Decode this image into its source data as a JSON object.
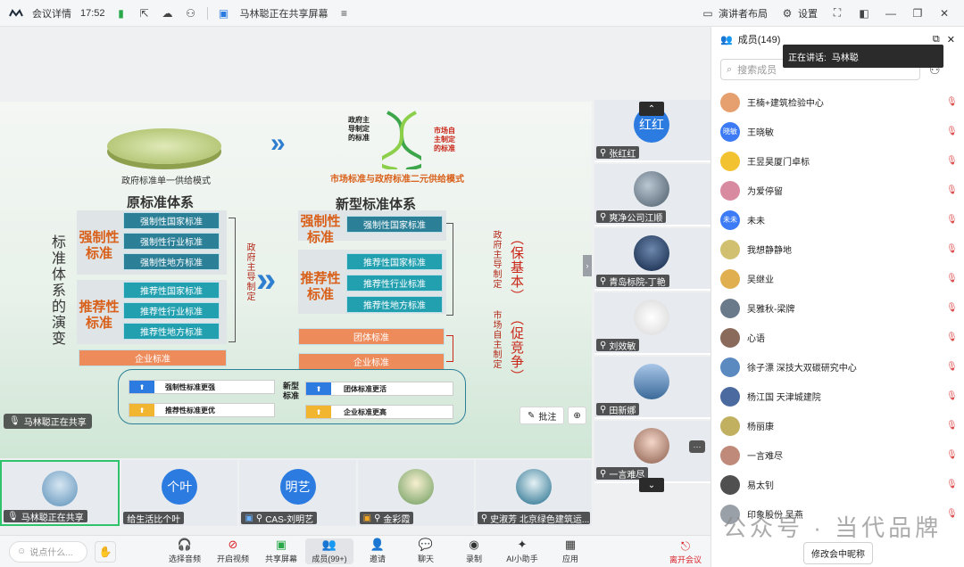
{
  "titlebar": {
    "app": "会议详情",
    "time": "17:52",
    "sharing_title": "马林聪正在共享屏幕",
    "layout_label": "演讲者布局",
    "settings_label": "设置"
  },
  "slide": {
    "left_top_caption": "政府标准单一供给模式",
    "right_top_caption": "市场标准与政府标准二元供给模式",
    "dna_left_label": "政府主导制定的标准",
    "dna_right_label": "市场自主制定的标准",
    "old_title": "原标准体系",
    "new_title": "新型标准体系",
    "side_title": "标准体系的演变",
    "mandatory_label": "强制性标准",
    "recommended_label": "推荐性标准",
    "old_mandatory": [
      "强制性国家标准",
      "强制性行业标准",
      "强制性地方标准"
    ],
    "old_recommended": [
      "推荐性国家标准",
      "推荐性行业标准",
      "推荐性地方标准"
    ],
    "old_enterprise": "企业标准",
    "gov_led": "政府主导制定",
    "new_mandatory": [
      "强制性国家标准"
    ],
    "new_recommended": [
      "推荐性国家标准",
      "推荐性行业标准",
      "推荐性地方标准"
    ],
    "new_group": "团体标准",
    "new_enterprise": "企业标准",
    "gov_led_right": "政府主导制定",
    "market_led": "市场自主制定",
    "bracket_top": "（保基本）",
    "bracket_bottom": "（促竞争）",
    "bottom_items": [
      "强制性标准更强",
      "推荐性标准更优",
      "团体标准更活",
      "企业标准更高"
    ],
    "bottom_center": "新型标准",
    "annotate": "批注"
  },
  "shared_badge": "马林聪正在共享",
  "side_tiles": [
    {
      "name": "张红红",
      "avatar_text": "红红",
      "color": "#2b7be0"
    },
    {
      "name": "爽净公司江顺",
      "avatar_text": "",
      "color": "#7a8c9a"
    },
    {
      "name": "青岛标院-丁艳",
      "avatar_text": "",
      "color": "#1b3b66"
    },
    {
      "name": "刘效敏",
      "avatar_text": "",
      "color": "#f0f0f0"
    },
    {
      "name": "田新娜",
      "avatar_text": "",
      "color": "#7aa0c8"
    },
    {
      "name": "一言难尽",
      "avatar_text": "",
      "color": "#c8a590"
    }
  ],
  "bottom_tiles": [
    {
      "name": "马林聪正在共享",
      "avatar_text": "",
      "color": "#5a8fb8"
    },
    {
      "name": "给生活比个叶",
      "avatar_text": "个叶",
      "color": "#2b7be0"
    },
    {
      "name": "CAS-刘明艺",
      "avatar_text": "明艺",
      "color": "#2b7be0"
    },
    {
      "name": "金彩霞",
      "avatar_text": "",
      "color": "#6a9a5c"
    },
    {
      "name": "史淑芳 北京绿色建筑运...",
      "avatar_text": "",
      "color": "#1d6a8a"
    }
  ],
  "panel": {
    "title": "成员(149)",
    "speaking_label": "正在讲话:",
    "speaking_name": "马林聪",
    "search_placeholder": "搜索成员",
    "members": [
      {
        "name": "王楠+建筑检验中心",
        "color": "#e6a070",
        "text": ""
      },
      {
        "name": "王晓敏",
        "color": "#3c7bf5",
        "text": "晓敏"
      },
      {
        "name": "王昱昊厦门卓标",
        "color": "#f2c230",
        "text": ""
      },
      {
        "name": "为爱停留",
        "color": "#d88aa0",
        "text": ""
      },
      {
        "name": "未未",
        "color": "#3c7bf5",
        "text": "未未"
      },
      {
        "name": "我想静静地",
        "color": "#d0c070",
        "text": ""
      },
      {
        "name": "吴继业",
        "color": "#e0b050",
        "text": ""
      },
      {
        "name": "吴雅秋-梁牌",
        "color": "#6a7a8a",
        "text": ""
      },
      {
        "name": "心语",
        "color": "#8a6a5a",
        "text": ""
      },
      {
        "name": "徐子漂 深技大双碳研究中心",
        "color": "#5a8ac0",
        "text": ""
      },
      {
        "name": "杨江国 天津城建院",
        "color": "#4a6aa0",
        "text": ""
      },
      {
        "name": "杨丽康",
        "color": "#c0b060",
        "text": ""
      },
      {
        "name": "一言难尽",
        "color": "#c08a7a",
        "text": ""
      },
      {
        "name": "易太钊",
        "color": "#505050",
        "text": ""
      },
      {
        "name": "印象股份 吴燕",
        "color": "#9aa0a8",
        "text": ""
      }
    ],
    "rename_button": "修改会中昵称"
  },
  "watermark": "公众号 · 当代品牌",
  "toolbar": {
    "say_placeholder": "说点什么...",
    "items": [
      "选择音频",
      "开启视频",
      "共享屏幕",
      "成员(99+)",
      "邀请",
      "聊天",
      "录制",
      "AI小助手",
      "应用"
    ],
    "leave": "离开会议"
  }
}
